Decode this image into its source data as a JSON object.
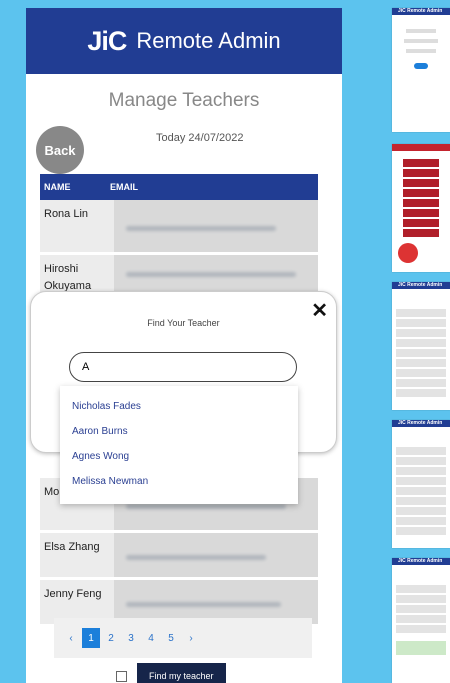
{
  "app": {
    "logo_text": "JiC",
    "header_title": "Remote Admin"
  },
  "page": {
    "title": "Manage Teachers",
    "date": "Today 24/07/2022",
    "back_label": "Back"
  },
  "table": {
    "columns": [
      "NAME",
      "EMAIL"
    ],
    "rows": [
      {
        "name": "Rona Lin"
      },
      {
        "name": "Hiroshi Okuyama"
      },
      {
        "name": "Mor Kar"
      },
      {
        "name": "Elsa Zhang"
      },
      {
        "name": "Jenny Feng"
      }
    ]
  },
  "modal": {
    "title": "Find Your Teacher",
    "close_label": "✕",
    "search_value": "A"
  },
  "suggestions": [
    "Nicholas Fades",
    "Aaron Burns",
    "Agnes Wong",
    "Melissa Newman"
  ],
  "pagination": {
    "prev": "‹",
    "pages": [
      "1",
      "2",
      "3",
      "4",
      "5"
    ],
    "next": "›",
    "current": "1"
  },
  "bottom": {
    "button_label": "Find my teacher"
  },
  "thumbnails": [
    {
      "header": "JiC Remote Admin"
    },
    {
      "header": ""
    },
    {
      "header": "JiC Remote Admin"
    },
    {
      "header": "JiC Remote Admin"
    },
    {
      "header": "JiC Remote Admin"
    }
  ],
  "colors": {
    "brand_blue": "#213d93",
    "background": "#5cc3ee",
    "logo_red": "#e2333d",
    "link": "#2a3f92"
  }
}
